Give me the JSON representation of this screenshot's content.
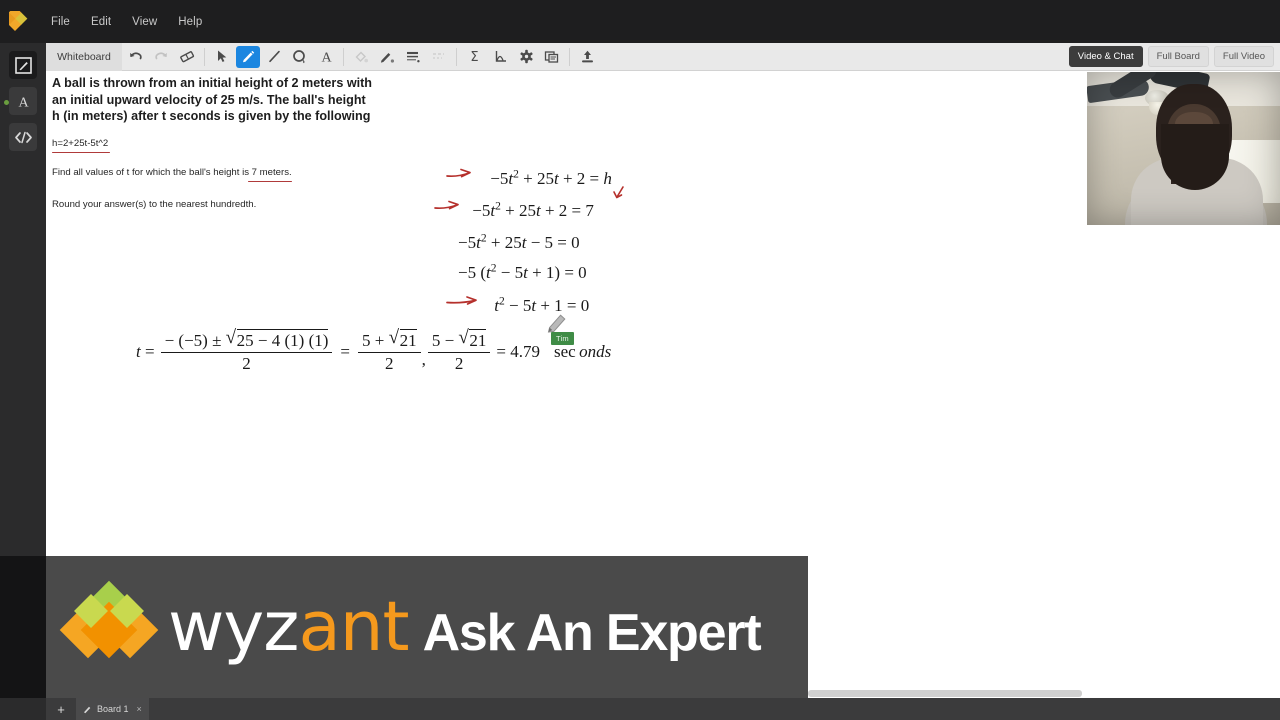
{
  "app": {
    "logo_icon": "wyzant-diamond-icon",
    "menu": [
      {
        "label": "File",
        "name": "menu-file"
      },
      {
        "label": "Edit",
        "name": "menu-edit"
      },
      {
        "label": "View",
        "name": "menu-view"
      },
      {
        "label": "Help",
        "name": "menu-help"
      }
    ]
  },
  "rail": {
    "items": [
      {
        "name": "sidebar-item-whiteboard",
        "icon": "pencil-board-icon",
        "active": true,
        "status": "online"
      },
      {
        "name": "sidebar-item-text",
        "icon": "text-A-icon",
        "active": false
      },
      {
        "name": "sidebar-item-code",
        "icon": "code-brackets-icon",
        "active": false
      }
    ]
  },
  "toolbar": {
    "board_label": "Whiteboard",
    "tools": [
      {
        "name": "undo-button",
        "icon": "undo-arrow-icon",
        "state": "enabled"
      },
      {
        "name": "redo-button",
        "icon": "redo-arrow-icon",
        "state": "disabled"
      },
      {
        "name": "eraser-button",
        "icon": "eraser-icon",
        "state": "enabled"
      },
      {
        "name": "select-button",
        "icon": "cursor-arrow-icon",
        "state": "enabled"
      },
      {
        "name": "pen-button",
        "icon": "pencil-icon",
        "state": "selected"
      },
      {
        "name": "line-button",
        "icon": "line-icon",
        "state": "enabled"
      },
      {
        "name": "shape-button",
        "icon": "circle-shape-icon",
        "state": "enabled"
      },
      {
        "name": "text-button",
        "icon": "text-A-icon",
        "state": "enabled"
      },
      {
        "name": "fill-button",
        "icon": "paint-bucket-icon",
        "state": "disabled"
      },
      {
        "name": "stroke-color-button",
        "icon": "pen-color-icon",
        "state": "enabled"
      },
      {
        "name": "line-weight-button",
        "icon": "line-weight-icon",
        "state": "enabled"
      },
      {
        "name": "line-style-button",
        "icon": "dashed-line-icon",
        "state": "disabled"
      },
      {
        "name": "equation-button",
        "icon": "sigma-icon",
        "state": "enabled"
      },
      {
        "name": "graph-button",
        "icon": "graph-axes-icon",
        "state": "enabled"
      },
      {
        "name": "settings-button",
        "icon": "gear-icon",
        "state": "enabled"
      },
      {
        "name": "import-button",
        "icon": "copy-pages-icon",
        "state": "enabled"
      },
      {
        "name": "upload-button",
        "icon": "upload-icon",
        "state": "enabled"
      }
    ],
    "view_buttons": [
      {
        "label": "Video & Chat",
        "name": "video-and-chat-button",
        "active": true
      },
      {
        "label": "Full Board",
        "name": "full-board-button",
        "active": false
      },
      {
        "label": "Full Video",
        "name": "full-video-button",
        "active": false
      }
    ]
  },
  "problem": {
    "title": "A ball is thrown from an initial height of 2 meters with an initial upward velocity of 25 m/s. The ball's height h (in meters) after t seconds is given by the following",
    "equation": "h=2+25t-5t^2",
    "find": "Find all values of t for which the ball's height is 7 meters.",
    "round": "Round your answer(s) to the nearest hundredth."
  },
  "work": {
    "lines": [
      {
        "name": "work-line-1",
        "arrow": true,
        "text": "-5t² + 25t + 2 = h"
      },
      {
        "name": "work-line-2",
        "arrow": true,
        "text": "-5t² + 25t + 2 = 7",
        "annotation": "down-arrow-over-7"
      },
      {
        "name": "work-line-3",
        "arrow": false,
        "text": "-5t² + 25t - 5 = 0"
      },
      {
        "name": "work-line-4",
        "arrow": false,
        "text": "-5 (t² - 5t + 1) = 0"
      },
      {
        "name": "work-line-5",
        "arrow": true,
        "text": "t² - 5t + 1 = 0"
      }
    ],
    "quadratic": {
      "lhs": "t =",
      "numerator": "- (-5) ± √(25 - 4 (1) (1))",
      "denominator": "2",
      "frac1_num": "5 + √21",
      "frac1_den": "2",
      "comma": ",",
      "frac2_num": "5 - √21",
      "frac2_den": "2",
      "result": "= 4.79",
      "units": "sec onds"
    },
    "cursor_name": "Tim"
  },
  "banner": {
    "brand_first": "wyz",
    "brand_second": "ant",
    "tagline": "Ask An Expert",
    "colors": {
      "orange": "#f5991d",
      "green": "#a8cf4b",
      "background": "#4a4a4a"
    }
  },
  "bottom": {
    "add_tab_label": "+",
    "tabs": [
      {
        "label": "Board 1",
        "icon": "pencil-icon",
        "close": "×",
        "name": "board-tab-1"
      }
    ]
  },
  "colors": {
    "accent_blue": "#1b86e0",
    "ink_red": "#b5302c",
    "name_tag_green": "#3f8c46"
  }
}
